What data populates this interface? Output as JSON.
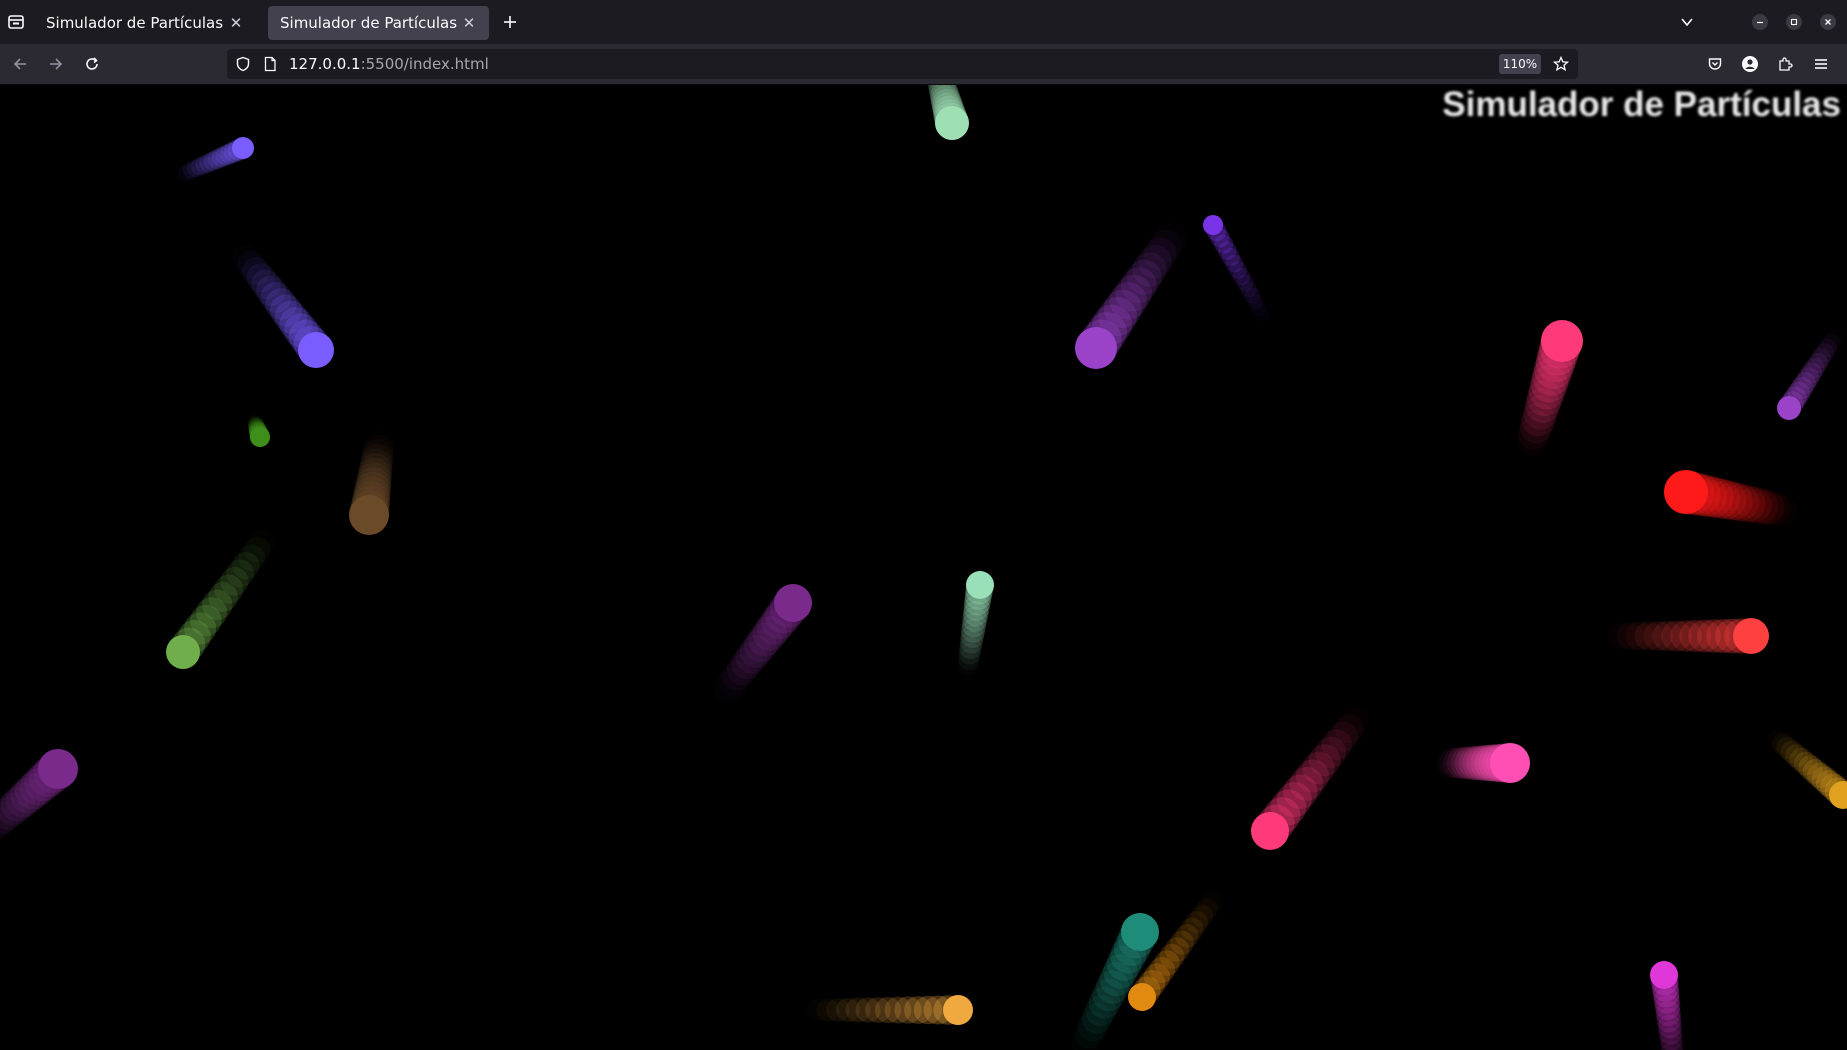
{
  "browser": {
    "tabs": [
      {
        "title": "Simulador de Partículas",
        "active": false
      },
      {
        "title": "Simulador de Partículas",
        "active": true
      }
    ],
    "url": {
      "host": "127.0.0.1",
      "rest": ":5500/index.html"
    },
    "zoom": "110%"
  },
  "page": {
    "heading": "Simulador de Partículas",
    "background": "#000000",
    "particles": [
      {
        "color": "#7b5cff"
      },
      {
        "color": "#7b5cff"
      },
      {
        "color": "#9edfb4"
      },
      {
        "color": "#7a34e8"
      },
      {
        "color": "#9a42c8"
      },
      {
        "color": "#ff3a7a"
      },
      {
        "color": "#9a42c8"
      },
      {
        "color": "#3e8e1a"
      },
      {
        "color": "#ff1a1a"
      },
      {
        "color": "#6b4a2a"
      },
      {
        "color": "#6fae4a"
      },
      {
        "color": "#9adfb8"
      },
      {
        "color": "#7a2a8a"
      },
      {
        "color": "#ff4040"
      },
      {
        "color": "#7a2a8a"
      },
      {
        "color": "#ff4fb4"
      },
      {
        "color": "#ff3a7a"
      },
      {
        "color": "#e0a020"
      },
      {
        "color": "#1f8c7a"
      },
      {
        "color": "#e08a12"
      },
      {
        "color": "#f0a840"
      },
      {
        "color": "#e038d8"
      }
    ]
  }
}
